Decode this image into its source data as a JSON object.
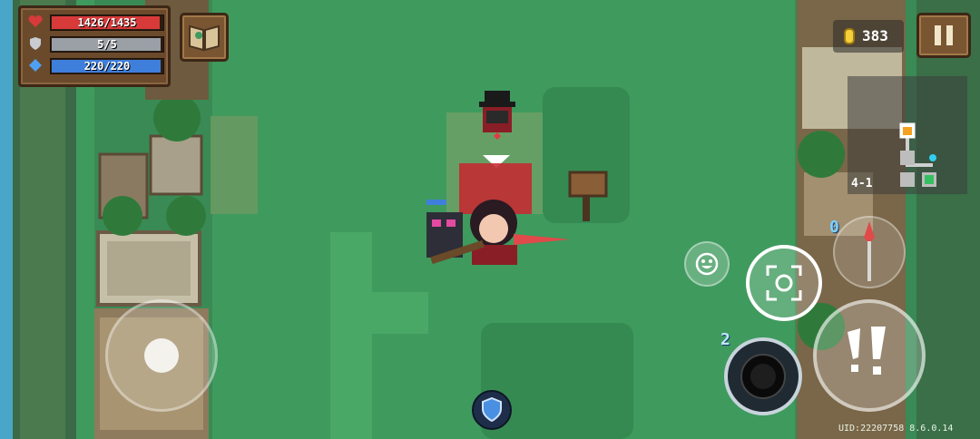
{
  "hud": {
    "health": {
      "text": "1426/1435",
      "current": 1426,
      "max": 1435
    },
    "armor": {
      "text": "5/5",
      "current": 5,
      "max": 5
    },
    "energy": {
      "text": "220/220",
      "current": 220,
      "max": 220
    }
  },
  "currency": {
    "coins": "383"
  },
  "minimap": {
    "level": "4-1"
  },
  "skills": {
    "skill_charges": "2",
    "weapon_energy_cost": "0"
  },
  "build_info": "UID:22207758 8.6.0.14",
  "colors": {
    "grass": "#3f9a5e",
    "health": "#d83a3a",
    "armor": "#9aa0a6",
    "energy": "#3f7fdc",
    "wood": "#6b4a2c"
  }
}
